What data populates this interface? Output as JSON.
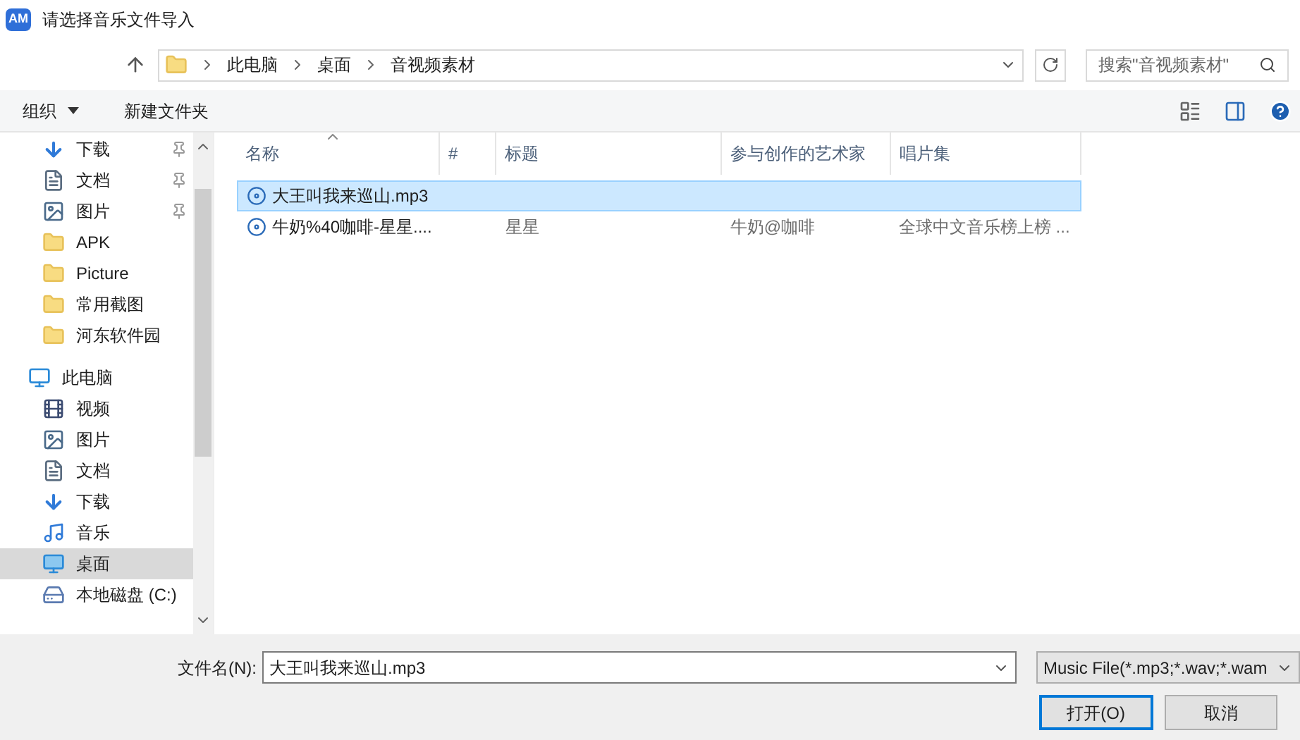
{
  "window": {
    "app_badge": "AM",
    "title": "请选择音乐文件导入"
  },
  "address_bar": {
    "crumbs": [
      "此电脑",
      "桌面",
      "音视频素材"
    ]
  },
  "search": {
    "placeholder": "搜索\"音视频素材\""
  },
  "toolbar": {
    "organize": "组织",
    "new_folder": "新建文件夹"
  },
  "sidebar": {
    "items": [
      {
        "label": "下载",
        "kind": "download",
        "pinned": true,
        "selected": false
      },
      {
        "label": "文档",
        "kind": "document",
        "pinned": true,
        "selected": false
      },
      {
        "label": "图片",
        "kind": "picture",
        "pinned": true,
        "selected": false
      },
      {
        "label": "APK",
        "kind": "folder",
        "pinned": false,
        "selected": false
      },
      {
        "label": "Picture",
        "kind": "folder",
        "pinned": false,
        "selected": false
      },
      {
        "label": "常用截图",
        "kind": "folder",
        "pinned": false,
        "selected": false
      },
      {
        "label": "河东软件园",
        "kind": "folder",
        "pinned": false,
        "selected": false
      },
      {
        "label": "此电脑",
        "kind": "computer",
        "pinned": false,
        "selected": false
      },
      {
        "label": "视频",
        "kind": "video",
        "pinned": false,
        "selected": false
      },
      {
        "label": "图片",
        "kind": "picture",
        "pinned": false,
        "selected": false
      },
      {
        "label": "文档",
        "kind": "document",
        "pinned": false,
        "selected": false
      },
      {
        "label": "下载",
        "kind": "download",
        "pinned": false,
        "selected": false
      },
      {
        "label": "音乐",
        "kind": "music",
        "pinned": false,
        "selected": false
      },
      {
        "label": "桌面",
        "kind": "desktop",
        "pinned": false,
        "selected": true
      },
      {
        "label": "本地磁盘 (C:)",
        "kind": "drive",
        "pinned": false,
        "selected": false
      }
    ]
  },
  "table": {
    "columns": [
      "名称",
      "#",
      "标题",
      "参与创作的艺术家",
      "唱片集"
    ],
    "rows": [
      {
        "selected": true,
        "cells": [
          "大王叫我来巡山.mp3",
          "",
          "",
          "",
          ""
        ]
      },
      {
        "selected": false,
        "cells": [
          "牛奶%40咖啡-星星....",
          "",
          "星星",
          "牛奶@咖啡",
          "全球中文音乐榜上榜 ..."
        ]
      }
    ]
  },
  "filename": {
    "label": "文件名(N):",
    "value": "大王叫我来巡山.mp3"
  },
  "file_type": {
    "value": "Music File(*.mp3;*.wav;*.wam"
  },
  "buttons": [
    "打开(O)",
    "取消"
  ]
}
